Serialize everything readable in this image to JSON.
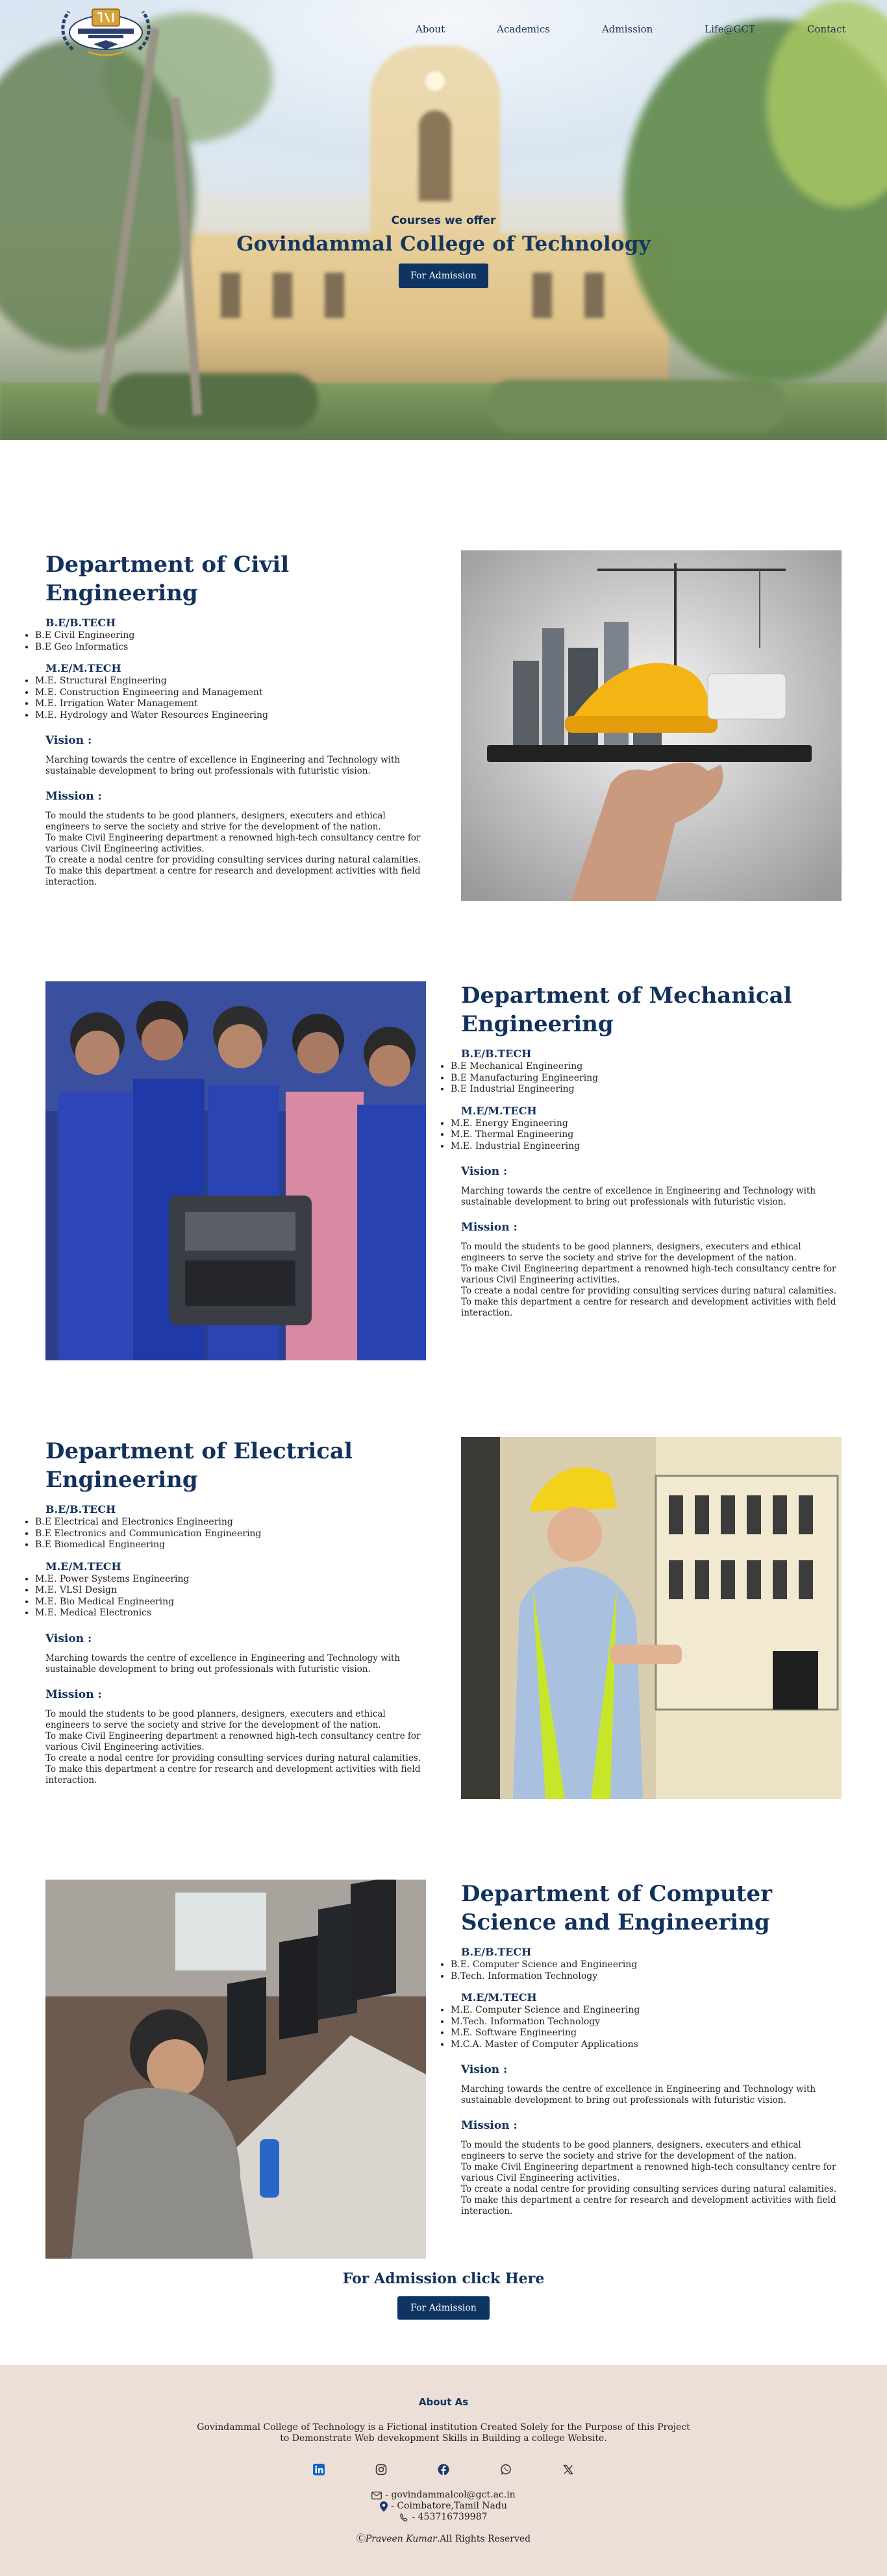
{
  "nav": {
    "logo_alt": "Govindammal College of Technology logo",
    "links": [
      "About",
      "Academics",
      "Admission",
      "Life@GCT",
      "Contact"
    ]
  },
  "hero": {
    "subtitle": "Courses we offer",
    "title": "Govindammal College of Technology",
    "button": "For Admission"
  },
  "departments": [
    {
      "title": "Department of Civil Engineering",
      "ug_heading": "B.E/B.TECH",
      "ug": [
        "B.E Civil Engineering",
        "B.E Geo Informatics"
      ],
      "pg_heading": "M.E/M.TECH",
      "pg": [
        "M.E. Structural Engineering",
        "M.E. Construction Engineering and Management",
        "M.E. Irrigation Water Management",
        "M.E. Hydrology and Water Resources Engineering"
      ],
      "vision_heading": "Vision :",
      "vision": "Marching towards the centre of excellence in Engineering and Technology with sustainable development to bring out professionals with futuristic vision.",
      "mission_heading": "Mission :",
      "mission": [
        "To mould the students to be good planners, designers, executers and ethical engineers to serve the society and strive for the development of the nation.",
        "To make Civil Engineering department a renowned high-tech consultancy centre for various Civil Engineering activities.",
        "To create a nodal centre for providing consulting services during natural calamities.",
        "To make this department a centre for research and development activities with field interaction."
      ]
    },
    {
      "title": "Department of Mechanical Engineering",
      "ug_heading": "B.E/B.TECH",
      "ug": [
        "B.E Mechanical Engineering",
        "B.E Manufacturing Engineering",
        "B.E Industrial Engineering"
      ],
      "pg_heading": "M.E/M.TECH",
      "pg": [
        "M.E. Energy Engineering",
        "M.E. Thermal Engineering",
        "M.E. Industrial Engineering"
      ],
      "vision_heading": "Vision :",
      "vision": "Marching towards the centre of excellence in Engineering and Technology with sustainable development to bring out professionals with futuristic vision.",
      "mission_heading": "Mission :",
      "mission": [
        "To mould the students to be good planners, designers, executers and ethical engineers to serve the society and strive for the development of the nation.",
        "To make Civil Engineering department a renowned high-tech consultancy centre for various Civil Engineering activities.",
        "To create a nodal centre for providing consulting services during natural calamities.",
        "To make this department a centre for research and development activities with field interaction."
      ]
    },
    {
      "title": "Department of Electrical Engineering",
      "ug_heading": "B.E/B.TECH",
      "ug": [
        "B.E Electrical and Electronics Engineering",
        "B.E Electronics and Communication Engineering",
        "B.E Biomedical Engineering"
      ],
      "pg_heading": "M.E/M.TECH",
      "pg": [
        "M.E. Power Systems Engineering",
        "M.E. VLSI Design",
        "M.E. Bio Medical Engineering",
        "M.E. Medical Electronics"
      ],
      "vision_heading": "Vision :",
      "vision": "Marching towards the centre of excellence in Engineering and Technology with sustainable development to bring out professionals with futuristic vision.",
      "mission_heading": "Mission :",
      "mission": [
        "To mould the students to be good planners, designers, executers and ethical engineers to serve the society and strive for the development of the nation.",
        "To make Civil Engineering department a renowned high-tech consultancy centre for various Civil Engineering activities.",
        "To create a nodal centre for providing consulting services during natural calamities.",
        "To make this department a centre for research and development activities with field interaction."
      ]
    },
    {
      "title": "Department of Computer Science and Engineering",
      "ug_heading": "B.E/B.TECH",
      "ug": [
        "B.E. Computer Science and Engineering",
        "B.Tech. Information Technology"
      ],
      "pg_heading": "M.E/M.TECH",
      "pg": [
        "M.E. Computer Science and Engineering",
        "M.Tech. Information Technology",
        "M.E. Software Engineering",
        "M.C.A. Master of Computer Applications"
      ],
      "vision_heading": "Vision :",
      "vision": "Marching towards the centre of excellence in Engineering and Technology with sustainable development to bring out professionals with futuristic vision.",
      "mission_heading": "Mission :",
      "mission": [
        "To mould the students to be good planners, designers, executers and ethical engineers to serve the society and strive for the development of the nation.",
        "To make Civil Engineering department a renowned high-tech consultancy centre for various Civil Engineering activities.",
        "To create a nodal centre for providing consulting services during natural calamities.",
        "To make this department a centre for research and development activities with field interaction."
      ]
    }
  ],
  "cta": {
    "title": "For Admission click Here",
    "button": "For Admission"
  },
  "footer": {
    "title": "About As",
    "about": "Govindammal College of Technology is a Fictional institution Created Solely for the Purpose of this Project to Demonstrate Web devekopment Skills in Building a college Website.",
    "socials": [
      "linkedin-icon",
      "instagram-icon",
      "facebook-icon",
      "whatsapp-icon",
      "x-icon"
    ],
    "email": "- govindammalcol@gct.ac.in",
    "location": "- Coimbatore,Tamil Nadu",
    "phone": "- 453716739987",
    "copyright_symbol": "Ⓒ",
    "author": "Praveen Kumar",
    "rights": ".All Rights Reserved"
  },
  "colors": {
    "primary": "#12315c",
    "button": "#0e3463",
    "footer_bg": "#ecdfd8"
  }
}
